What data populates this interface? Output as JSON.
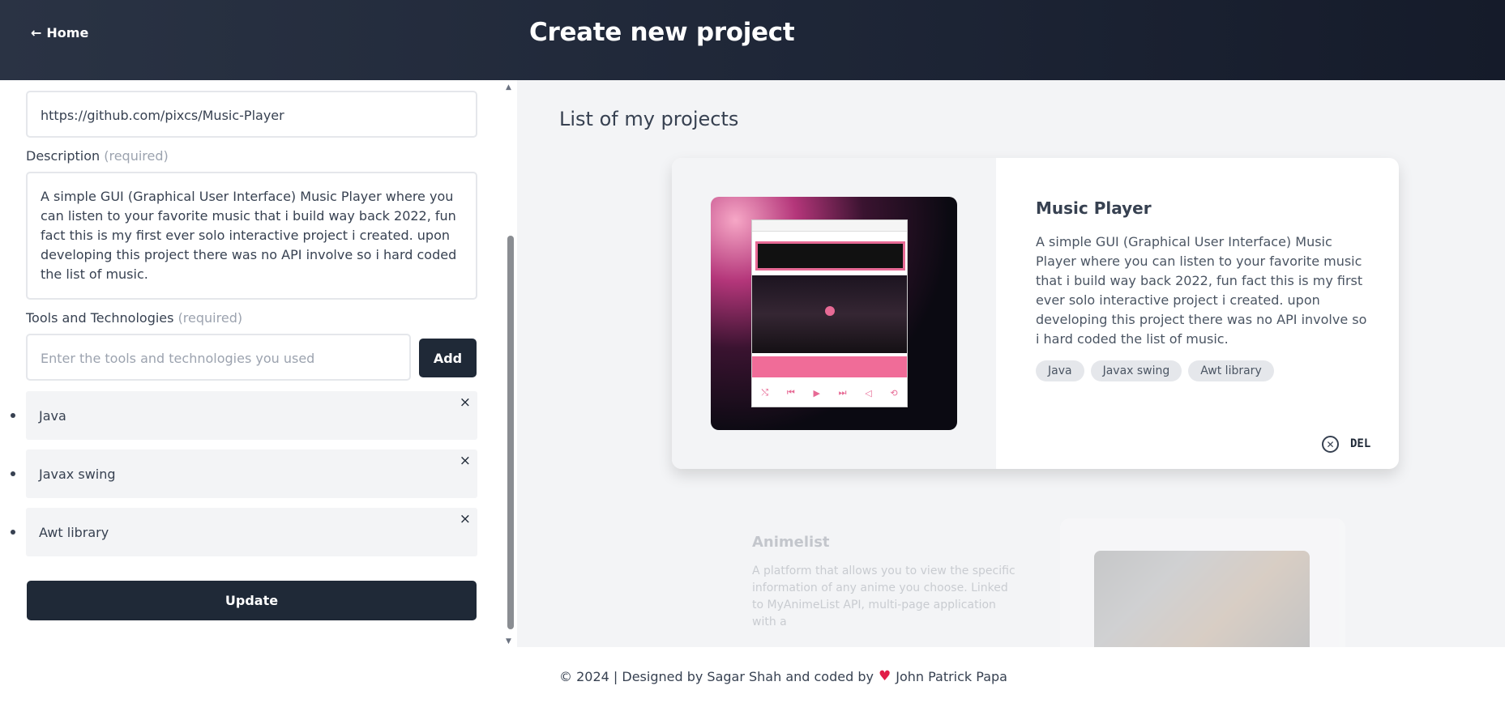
{
  "header": {
    "home_label": "Home",
    "title": "Create new project"
  },
  "form": {
    "repo_url_value": "https://github.com/pixcs/Music-Player",
    "description_label": "Description",
    "description_required": "(required)",
    "description_value": "A simple GUI (Graphical User Interface) Music Player where you can listen to your favorite music that i build way back 2022, fun fact this is my first ever solo interactive project i created. upon developing this project there was no API involve so i hard coded the list of music.",
    "tools_label": "Tools and Technologies",
    "tools_required": "(required)",
    "tools_placeholder": "Enter the tools and technologies you used",
    "add_label": "Add",
    "tools": [
      "Java",
      "Javax swing",
      "Awt library"
    ],
    "remove_icon": "×",
    "update_label": "Update"
  },
  "list": {
    "title": "List of my projects",
    "projects": [
      {
        "title": "Music Player",
        "description": "A simple GUI (Graphical User Interface) Music Player where you can listen to your favorite music that i build way back 2022, fun fact this is my first ever solo interactive project i created. upon developing this project there was no API involve so i hard coded the list of music.",
        "tags": [
          "Java",
          "Javax swing",
          "Awt library"
        ],
        "delete_label": "DEL"
      },
      {
        "title": "Animelist",
        "description": "A platform that allows you to view the specific information of any anime you choose. Linked to MyAnimeList API, multi-page application with a"
      }
    ]
  },
  "footer": {
    "prefix": "© 2024 | Designed by Sagar Shah and coded by",
    "author": "John Patrick Papa"
  },
  "colors": {
    "header_dark": "#1f2738",
    "button_dark": "#1f2937",
    "panel_gray": "#f3f4f6",
    "heart_red": "#e11d48"
  }
}
